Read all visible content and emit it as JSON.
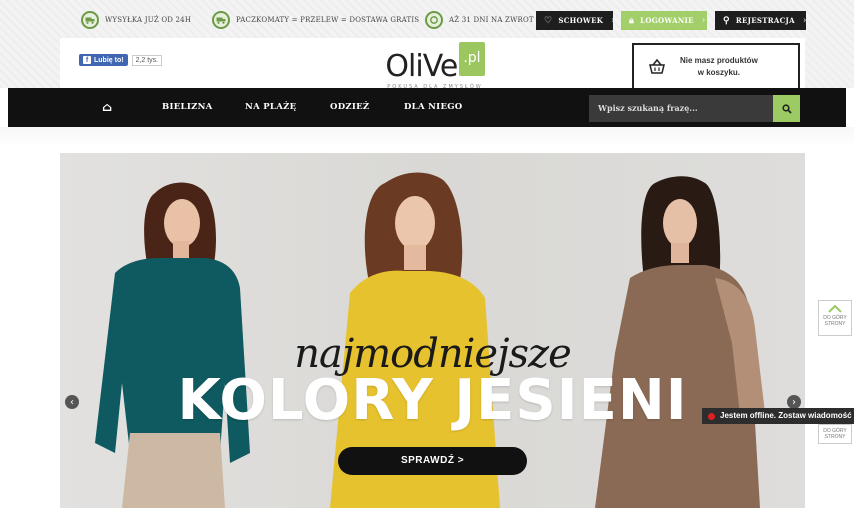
{
  "promos": [
    {
      "text": "Wysyłka już od 24h",
      "icon": "truck-icon"
    },
    {
      "text": "Paczkomaty = przelew = dostawa gratis",
      "icon": "truck-icon"
    },
    {
      "text": "Aż 31 dni na zwrot",
      "icon": "return-icon"
    }
  ],
  "account": {
    "wishlist": "Schowek",
    "login": "Logowanie",
    "register": "Rejestracja"
  },
  "facebook": {
    "like_label": "Lubię to!",
    "count": "2,2 tys."
  },
  "logo": {
    "name": "OliVe",
    "domain": ".pl",
    "tagline": "Pokusa dla zmysłów"
  },
  "cart": {
    "line1": "Nie masz produktów",
    "line2": "w koszyku.",
    "icon": "basket-icon"
  },
  "nav": {
    "home_icon": "home-icon",
    "items": [
      "Bielizna",
      "Na plażę",
      "Odzież",
      "Dla niego"
    ]
  },
  "search": {
    "placeholder": "Wpisz szukaną frazę...",
    "icon": "search-icon"
  },
  "hero": {
    "script": "najmodniejsze",
    "title": "KOLORY JESIENI",
    "cta": "SPRAWDŹ >"
  },
  "side": {
    "back_to_top": "DO GÓRY STRONY"
  },
  "chat": {
    "text": "Jestem offline. Zostaw wiadomość"
  },
  "colors": {
    "accent_green": "#9bcb62",
    "nav_dark": "#111111",
    "teal_blouse": "#0e5a60",
    "yellow_dress": "#e7c22f",
    "brown_dress": "#8a6a55"
  }
}
